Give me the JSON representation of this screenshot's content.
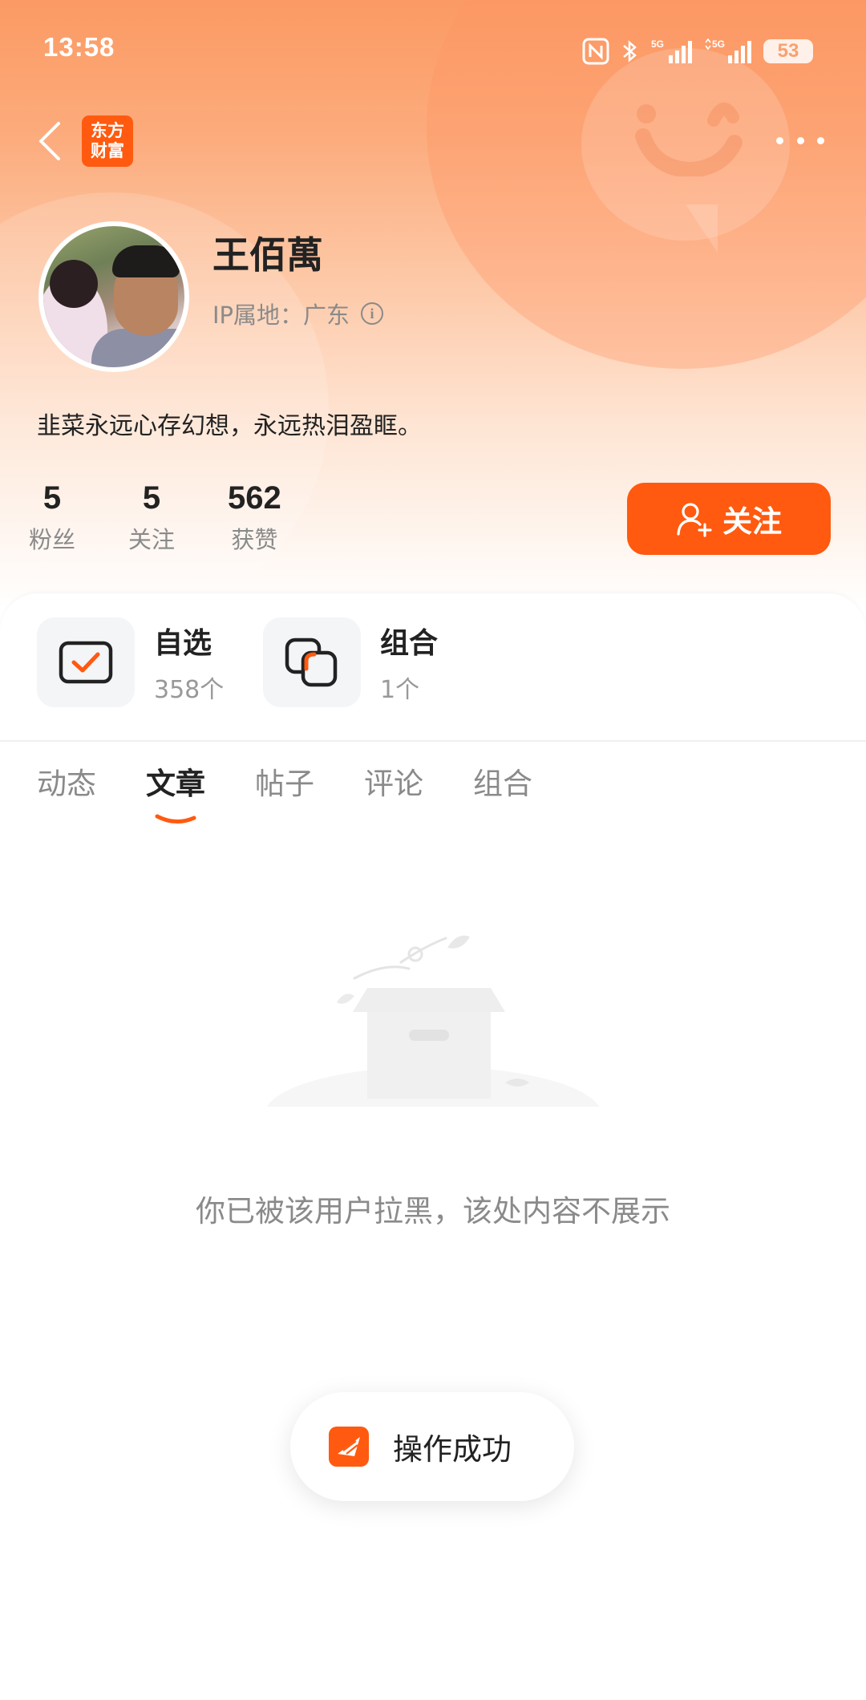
{
  "status_bar": {
    "time": "13:58",
    "network_1": "5G",
    "network_2": "5G",
    "battery": "53"
  },
  "nav": {
    "app_logo_line1": "东方",
    "app_logo_line2": "财富",
    "back_icon": "chevron-left-icon",
    "more_icon": "more-horizontal-icon"
  },
  "profile": {
    "name": "王佰萬",
    "ip_location": "IP属地：广东",
    "bio": "韭菜永远心存幻想，永远热泪盈眶。"
  },
  "stats": [
    {
      "value": "5",
      "label": "粉丝"
    },
    {
      "value": "5",
      "label": "关注"
    },
    {
      "value": "562",
      "label": "获赞"
    }
  ],
  "follow_button": {
    "label": "关注"
  },
  "shortcuts": [
    {
      "title": "自选",
      "count": "358个",
      "icon": "watchlist-check-icon"
    },
    {
      "title": "组合",
      "count": "1个",
      "icon": "portfolio-icon"
    }
  ],
  "tabs": [
    {
      "label": "动态",
      "active": false
    },
    {
      "label": "文章",
      "active": true
    },
    {
      "label": "帖子",
      "active": false
    },
    {
      "label": "评论",
      "active": false
    },
    {
      "label": "组合",
      "active": false
    }
  ],
  "empty_state": {
    "message": "你已被该用户拉黑，该处内容不展示",
    "icon": "empty-box-icon"
  },
  "toast": {
    "message": "操作成功"
  },
  "colors": {
    "accent": "#ff5a10",
    "header_gradient_top": "#fb9a63",
    "text_primary": "#222222",
    "text_secondary": "#8a8a8a"
  }
}
